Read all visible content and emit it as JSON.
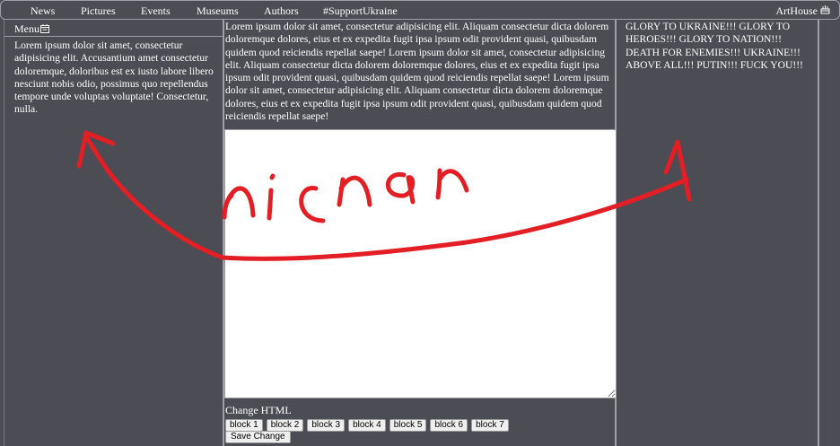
{
  "nav": {
    "items": [
      "News",
      "Pictures",
      "Events",
      "Museums",
      "Authors",
      "#SupportUkraine"
    ],
    "brand": "ArtHouse",
    "brand_icon": "cake-icon"
  },
  "left": {
    "menu_label": "Menu",
    "menu_icon": "calendar-icon",
    "text": "Lorem ipsum dolor sit amet, consectetur adipisicing elit. Accusantium amet consectetur doloremque, doloribus est ex iusto labore libero nesciunt nobis odio, possimus quo repellendus tempore unde voluptas voluptate! Consectetur, nulla."
  },
  "center": {
    "text": "Lorem ipsum dolor sit amet, consectetur adipisicing elit. Aliquam consectetur dicta dolorem doloremque dolores, eius et ex expedita fugit ipsa ipsum odit provident quasi, quibusdam quidem quod reiciendis repellat saepe! Lorem ipsum dolor sit amet, consectetur adipisicing elit. Aliquam consectetur dicta dolorem doloremque dolores, eius et ex expedita fugit ipsa ipsum odit provident quasi, quibusdam quidem quod reiciendis repellat saepe! Lorem ipsum dolor sit amet, consectetur adipisicing elit. Aliquam consectetur dicta dolorem doloremque dolores, eius et ex expedita fugit ipsa ipsum odit provident quasi, quibusdam quidem quod reiciendis repellat saepe!",
    "editor_value": "",
    "change_label": "Change HTML",
    "blocks": [
      "block 1",
      "block 2",
      "block 3",
      "block 4",
      "block 5",
      "block 6",
      "block 7"
    ],
    "save_label": "Save Change"
  },
  "right": {
    "text": "GLORY TO UKRAINE!!! GLORY TO HEROES!!! GLORY TO NATION!!! DEATH FOR ENEMIES!!! UKRAINE!!! ABOVE ALL!!! PUTIN!!! FUCK YOU!!!"
  },
  "annotation": {
    "handwriting": "nicnar",
    "color": "#e31e24"
  },
  "colors": {
    "background": "#4b4c54",
    "border": "#9e9ea6",
    "text": "#ffffff"
  }
}
